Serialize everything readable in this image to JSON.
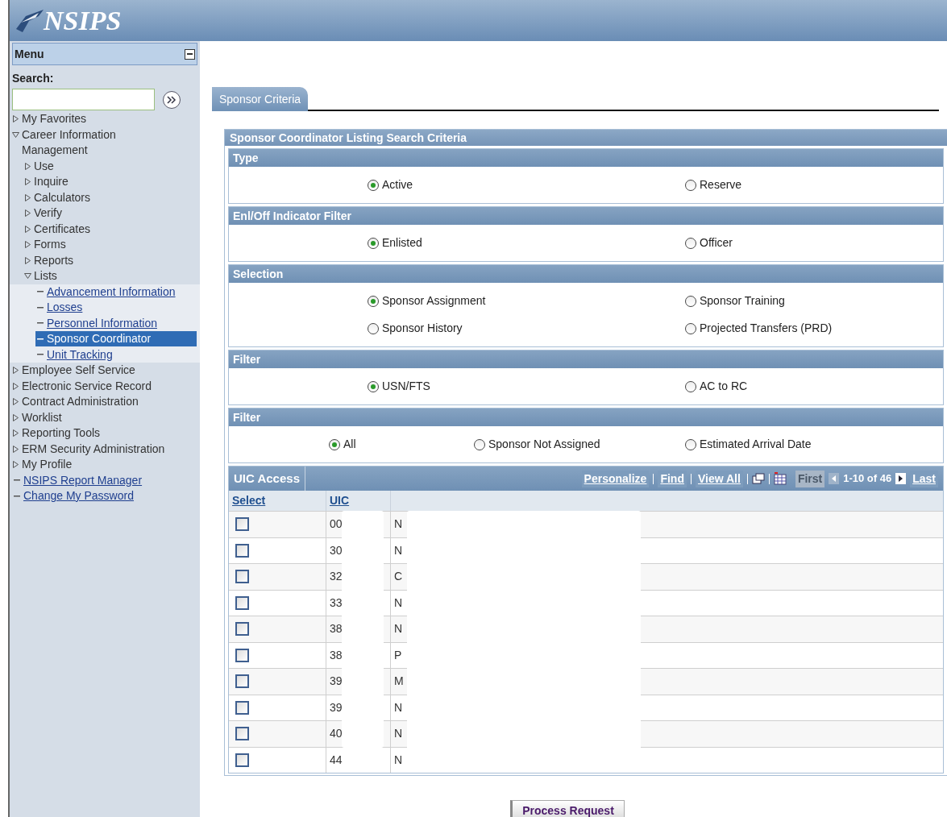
{
  "header": {
    "logo": "NSIPS"
  },
  "menu": {
    "title": "Menu",
    "search_label": "Search:",
    "items": [
      {
        "label": "My Favorites",
        "kind": "folder",
        "expanded": false
      },
      {
        "label": "Career Information Management",
        "kind": "folder",
        "expanded": true,
        "children": [
          {
            "label": "Use",
            "kind": "folder",
            "expanded": false
          },
          {
            "label": "Inquire",
            "kind": "folder",
            "expanded": false
          },
          {
            "label": "Calculators",
            "kind": "folder",
            "expanded": false
          },
          {
            "label": "Verify",
            "kind": "folder",
            "expanded": false
          },
          {
            "label": "Certificates",
            "kind": "folder",
            "expanded": false
          },
          {
            "label": "Forms",
            "kind": "folder",
            "expanded": false
          },
          {
            "label": "Reports",
            "kind": "folder",
            "expanded": false
          },
          {
            "label": "Lists",
            "kind": "folder",
            "expanded": true,
            "children": [
              {
                "label": "Advancement Information",
                "kind": "link",
                "selected": false
              },
              {
                "label": "Losses",
                "kind": "link",
                "selected": false
              },
              {
                "label": "Personnel Information",
                "kind": "link",
                "selected": false
              },
              {
                "label": "Sponsor Coordinator",
                "kind": "link",
                "selected": true
              },
              {
                "label": "Unit Tracking",
                "kind": "link",
                "selected": false
              }
            ]
          }
        ]
      },
      {
        "label": "Employee Self Service",
        "kind": "folder",
        "expanded": false
      },
      {
        "label": "Electronic Service Record",
        "kind": "folder",
        "expanded": false
      },
      {
        "label": "Contract Administration",
        "kind": "folder",
        "expanded": false
      },
      {
        "label": "Worklist",
        "kind": "folder",
        "expanded": false
      },
      {
        "label": "Reporting Tools",
        "kind": "folder",
        "expanded": false
      },
      {
        "label": "ERM Security Administration",
        "kind": "folder",
        "expanded": false
      },
      {
        "label": "My Profile",
        "kind": "folder",
        "expanded": false
      },
      {
        "label": "NSIPS Report Manager",
        "kind": "link",
        "selected": false
      },
      {
        "label": "Change My Password",
        "kind": "link",
        "selected": false
      }
    ]
  },
  "tabs": [
    {
      "label": "Sponsor Criteria",
      "selected": true
    }
  ],
  "criteria": {
    "title": "Sponsor Coordinator Listing Search Criteria",
    "groups": [
      {
        "title": "Type",
        "options": [
          {
            "label": "Active",
            "selected": true
          },
          {
            "label": "Reserve",
            "selected": false
          }
        ]
      },
      {
        "title": "Enl/Off Indicator Filter",
        "options": [
          {
            "label": "Enlisted",
            "selected": true
          },
          {
            "label": "Officer",
            "selected": false
          }
        ]
      },
      {
        "title": "Selection",
        "options": [
          {
            "label": "Sponsor Assignment",
            "selected": true
          },
          {
            "label": "Sponsor Training",
            "selected": false
          },
          {
            "label": "Sponsor History",
            "selected": false
          },
          {
            "label": "Projected Transfers (PRD)",
            "selected": false
          }
        ]
      },
      {
        "title": "Filter",
        "options": [
          {
            "label": "USN/FTS",
            "selected": true
          },
          {
            "label": "AC to RC",
            "selected": false
          }
        ]
      },
      {
        "title": "Filter",
        "options": [
          {
            "label": "All",
            "selected": true
          },
          {
            "label": "Sponsor Not Assigned",
            "selected": false
          },
          {
            "label": "Estimated Arrival Date",
            "selected": false
          }
        ]
      }
    ]
  },
  "grid": {
    "title": "UIC Access",
    "links": [
      "Personalize",
      "Find",
      "View All"
    ],
    "first": "First",
    "range": "1-10 of 46",
    "last": "Last",
    "columns": [
      "Select",
      "UIC"
    ],
    "rows": [
      {
        "checked": false,
        "uic": "00",
        "description": "N"
      },
      {
        "checked": false,
        "uic": "30",
        "description": "N"
      },
      {
        "checked": false,
        "uic": "32",
        "description": "C"
      },
      {
        "checked": false,
        "uic": "33",
        "description": "N"
      },
      {
        "checked": false,
        "uic": "38",
        "description": "N"
      },
      {
        "checked": false,
        "uic": "38",
        "description": "P"
      },
      {
        "checked": false,
        "uic": "39",
        "description": "M"
      },
      {
        "checked": false,
        "uic": "39",
        "description": "N"
      },
      {
        "checked": false,
        "uic": "40",
        "description": "N"
      },
      {
        "checked": false,
        "uic": "44",
        "description": "N"
      }
    ]
  },
  "actions": [
    "Process Request"
  ]
}
